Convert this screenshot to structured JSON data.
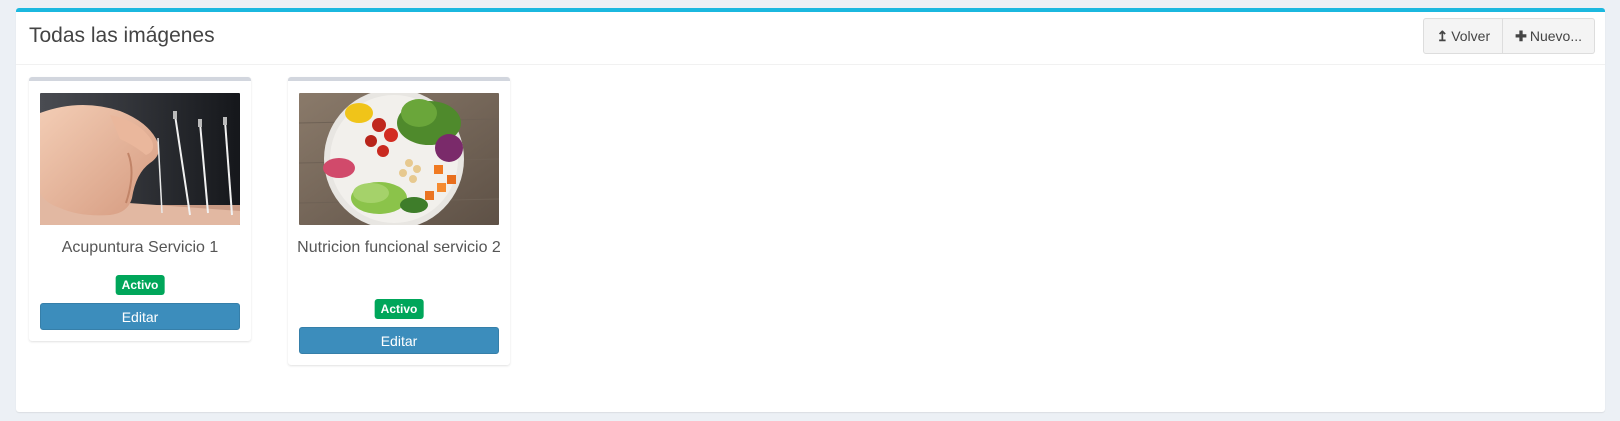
{
  "header": {
    "title": "Todas las imágenes",
    "back_label": "Volver",
    "new_label": "Nuevo..."
  },
  "icons": {
    "back": "level-up-icon",
    "new": "plus-icon"
  },
  "colors": {
    "box_border_top": "#1bb8df",
    "card_border_top": "#d2d6de",
    "status_active": "#00a65a",
    "edit_button": "#3c8dbc"
  },
  "images": [
    {
      "title": "Acupuntura Servicio 1",
      "status": "Activo",
      "edit_label": "Editar"
    },
    {
      "title": "Nutricion funcional servicio 2",
      "status": "Activo",
      "edit_label": "Editar"
    }
  ]
}
